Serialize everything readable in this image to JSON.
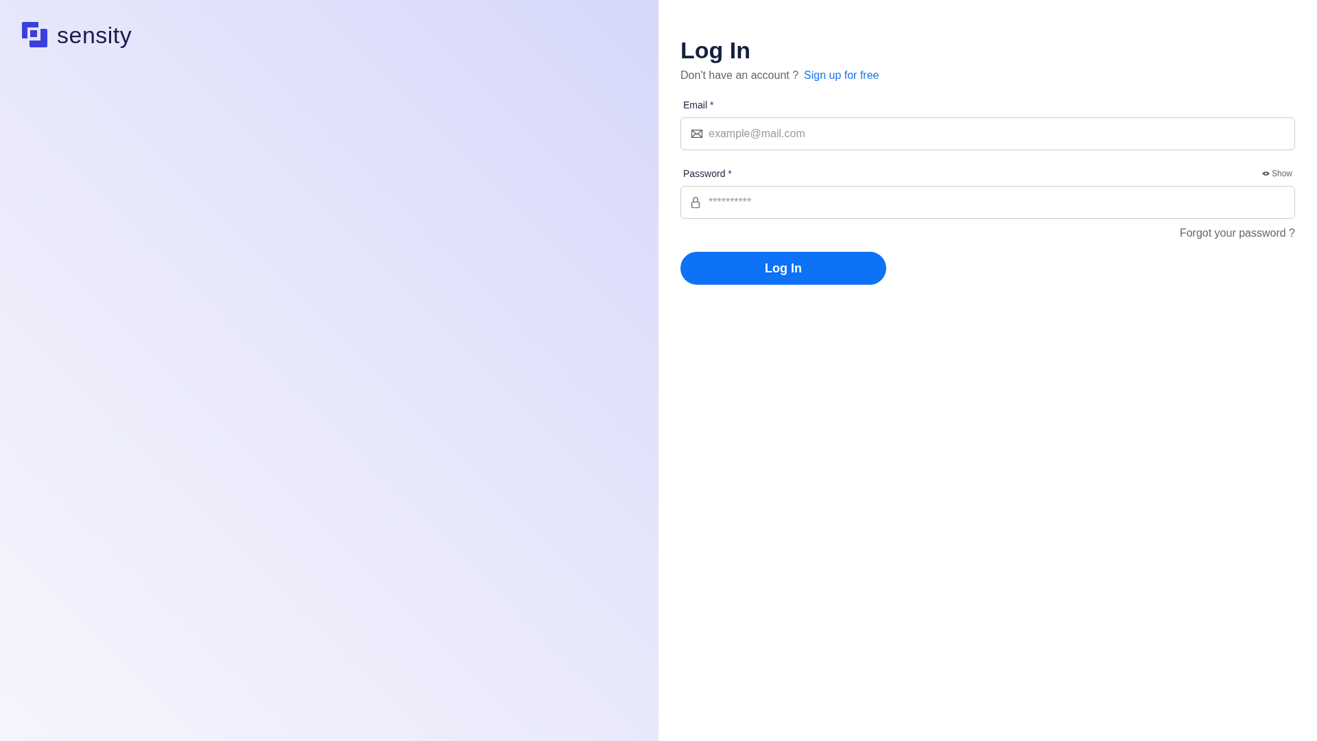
{
  "brand": {
    "name": "sensity"
  },
  "form": {
    "title": "Log In",
    "signup_prompt": "Don't have an account ?",
    "signup_link": "Sign up for free",
    "fields": [
      {
        "kind": "email",
        "label": "Email *",
        "placeholder": "example@mail.com"
      },
      {
        "kind": "password",
        "label": "Password *",
        "placeholder": "**********",
        "toggle": "Show"
      }
    ],
    "forgot_link": "Forgot your password ?",
    "submit": "Log In"
  }
}
